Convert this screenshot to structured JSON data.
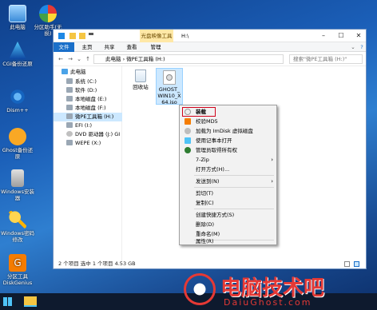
{
  "desktop": {
    "icons": [
      {
        "label": "此电脑",
        "icon": "computer-icon"
      },
      {
        "label": "分区助手(无损)",
        "icon": "partition-assistant-icon"
      },
      {
        "label": "CGI备份还原",
        "icon": "cgi-backup-icon"
      },
      {
        "label": "Dism++",
        "icon": "dism-icon"
      },
      {
        "label": "Ghost备份还原",
        "icon": "ghost-icon"
      },
      {
        "label": "Windows安装器",
        "icon": "windows-installer-icon"
      },
      {
        "label": "Windows密码修改",
        "icon": "password-key-icon"
      },
      {
        "label": "分区工具DiskGenius",
        "icon": "diskgenius-icon"
      }
    ]
  },
  "explorer": {
    "context_tab": "光盘映像工具",
    "title": "H:\\",
    "ribbon_tabs": [
      "文件",
      "主页",
      "共享",
      "查看",
      "管理"
    ],
    "address": {
      "path": [
        "此电脑",
        "微PE工具箱 (H:)"
      ],
      "search_placeholder": "搜索\"微PE工具箱 (H:)\""
    },
    "nav_items": [
      {
        "label": "此电脑",
        "icon": "computer-icon"
      },
      {
        "label": "系统 (C:)",
        "icon": "drive-icon"
      },
      {
        "label": "软件 (D:)",
        "icon": "drive-icon"
      },
      {
        "label": "本地磁盘 (E:)",
        "icon": "drive-icon"
      },
      {
        "label": "本地磁盘 (F:)",
        "icon": "drive-icon"
      },
      {
        "label": "微PE工具箱 (H:)",
        "icon": "drive-icon"
      },
      {
        "label": "EFI (I:)",
        "icon": "drive-icon"
      },
      {
        "label": "DVD 驱动器 (J:) GI",
        "icon": "dvd-icon"
      },
      {
        "label": "WEPE (X:)",
        "icon": "drive-icon"
      }
    ],
    "files": [
      {
        "label": "回收站",
        "icon": "recycle-bin-icon"
      },
      {
        "label": "GHOST_WIN10_X64.iso",
        "icon": "iso-disc-icon"
      }
    ],
    "status": "2 个项目   选中 1 个项目  4.53 GB"
  },
  "context_menu": {
    "items": [
      {
        "label": "装载",
        "icon": "disc-icon",
        "highlighted": true
      },
      {
        "label": "校验MD5",
        "icon": "shield-icon"
      },
      {
        "label": "加载为 ImDisk 虚拟磁盘",
        "icon": "imdisk-icon"
      },
      {
        "label": "使用记事本打开",
        "icon": "notepad-icon"
      },
      {
        "label": "管理员取得所有权",
        "icon": "admin-shield-icon"
      },
      {
        "label": "7-Zip",
        "submenu": true
      },
      {
        "label": "打开方式(H)..."
      },
      {
        "label": "发送到(N)",
        "submenu": true
      },
      {
        "label": "剪切(T)"
      },
      {
        "label": "复制(C)"
      },
      {
        "label": "创建快捷方式(S)"
      },
      {
        "label": "删除(D)"
      },
      {
        "label": "重命名(M)"
      },
      {
        "label": "属性(R)"
      }
    ],
    "highlight_color": "#d0021b"
  },
  "watermark": {
    "title": "电脑技术吧",
    "url": "DaiuGhost.com"
  },
  "colors": {
    "accent": "#1a6fc9",
    "brand_red": "#e53935"
  }
}
